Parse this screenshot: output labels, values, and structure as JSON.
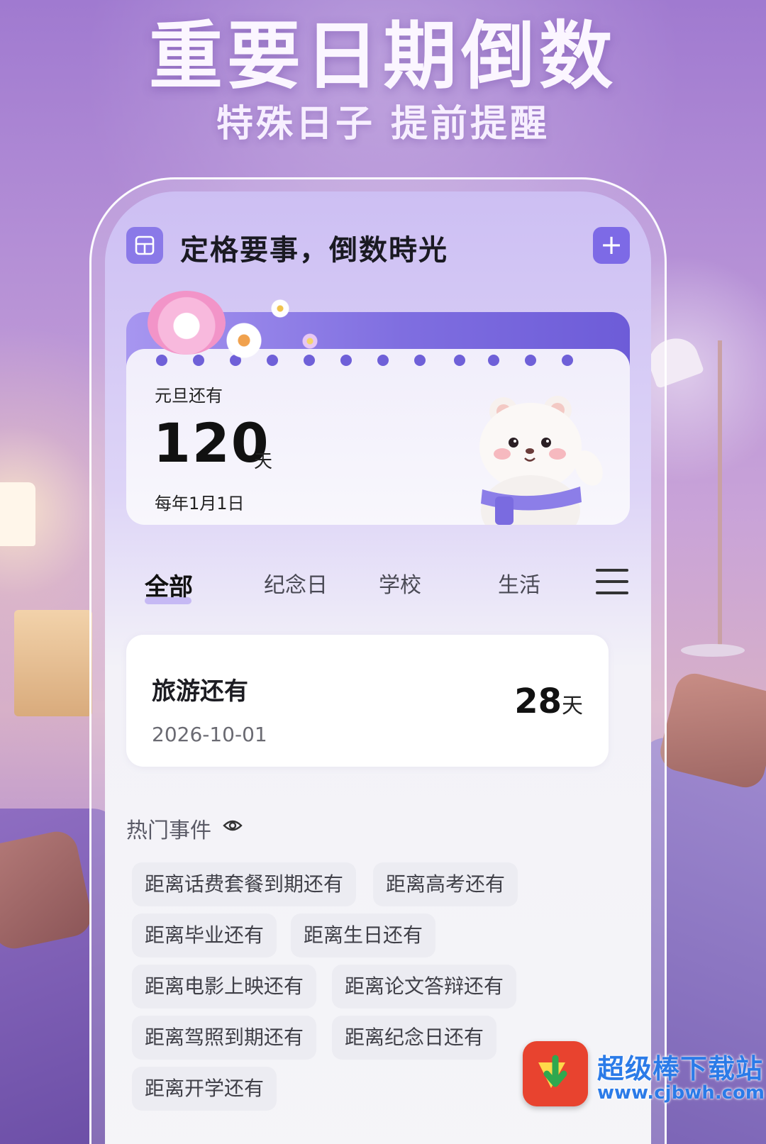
{
  "promo": {
    "headline": "重要日期倒数",
    "subline": "特殊日子 提前提醒"
  },
  "header": {
    "title": "定格要事，倒数時光",
    "add_label": "+"
  },
  "hero": {
    "label": "元旦还有",
    "days": "120",
    "unit": "天",
    "date": "每年1月1日"
  },
  "tabs": [
    {
      "label": "全部",
      "active": true
    },
    {
      "label": "纪念日",
      "active": false
    },
    {
      "label": "学校",
      "active": false
    },
    {
      "label": "生活",
      "active": false
    }
  ],
  "event": {
    "title": "旅游还有",
    "date": "2026-10-01",
    "days": "28",
    "unit": "天"
  },
  "hot": {
    "title": "热门事件",
    "chips": [
      "距离话费套餐到期还有",
      "距离高考还有",
      "距离毕业还有",
      "距离生日还有",
      "距离电影上映还有",
      "距离论文答辩还有",
      "距离驾照到期还有",
      "距离纪念日还有",
      "距离开学还有"
    ]
  },
  "watermark": {
    "title": "超级棒下载站",
    "url": "www.cjbwh.com"
  },
  "colors": {
    "accent": "#7d6ae6",
    "chip_bg": "#ececf2",
    "watermark": "#2b7be8"
  }
}
